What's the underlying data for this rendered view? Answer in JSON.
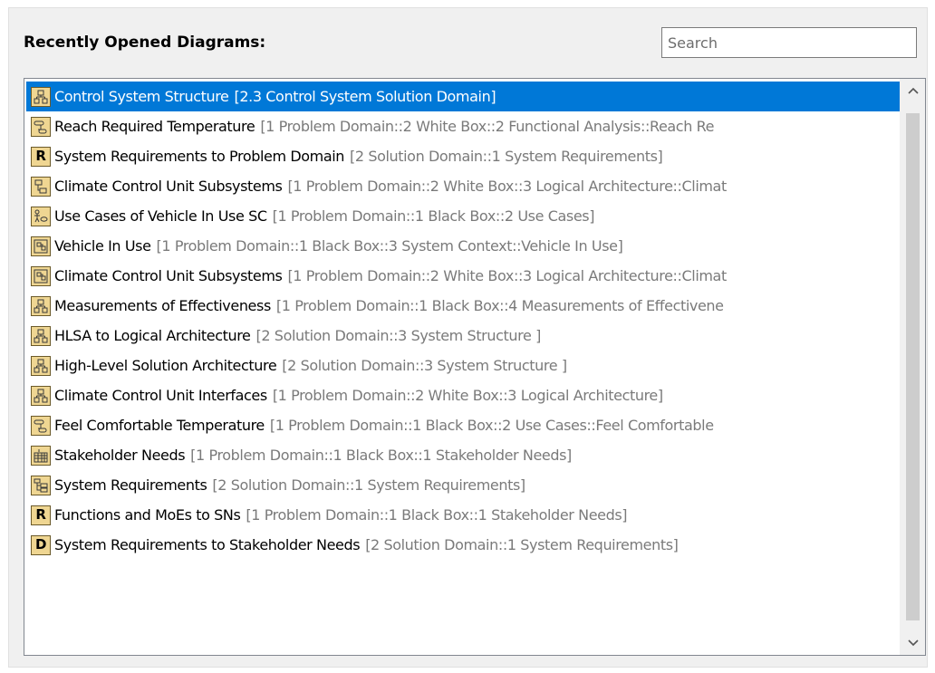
{
  "header": {
    "title": "Recently Opened Diagrams:"
  },
  "search": {
    "placeholder": "Search",
    "value": ""
  },
  "items": [
    {
      "icon": "class-diagram-icon",
      "name": "Control System Structure",
      "path": "[2.3 Control System Solution Domain]",
      "selected": true
    },
    {
      "icon": "activity-diagram-icon",
      "name": "Reach Required Temperature",
      "path": "[1 Problem Domain::2 White Box::2 Functional Analysis::Reach Re",
      "selected": false
    },
    {
      "icon": "requirement-diagram-icon",
      "name": "System Requirements to Problem Domain",
      "path": "[2 Solution Domain::1 System Requirements]",
      "selected": false
    },
    {
      "icon": "bdd-diagram-icon",
      "name": "Climate Control Unit Subsystems",
      "path": "[1 Problem Domain::2 White Box::3 Logical Architecture::Climat",
      "selected": false
    },
    {
      "icon": "use-case-diagram-icon",
      "name": "Use Cases of Vehicle In Use SC",
      "path": "[1 Problem Domain::1 Black Box::2 Use Cases]",
      "selected": false
    },
    {
      "icon": "ibd-diagram-icon",
      "name": "Vehicle In Use",
      "path": "[1 Problem Domain::1 Black Box::3 System Context::Vehicle In Use]",
      "selected": false
    },
    {
      "icon": "ibd-diagram-icon",
      "name": "Climate Control Unit Subsystems",
      "path": "[1 Problem Domain::2 White Box::3 Logical Architecture::Climat",
      "selected": false
    },
    {
      "icon": "class-diagram-icon",
      "name": "Measurements of Effectiveness",
      "path": "[1 Problem Domain::1 Black Box::4 Measurements of Effectivene",
      "selected": false
    },
    {
      "icon": "class-diagram-icon",
      "name": "HLSA to Logical Architecture",
      "path": "[2 Solution Domain::3 System Structure ]",
      "selected": false
    },
    {
      "icon": "class-diagram-icon",
      "name": "High-Level Solution Architecture",
      "path": "[2 Solution Domain::3 System Structure ]",
      "selected": false
    },
    {
      "icon": "class-diagram-icon",
      "name": "Climate Control Unit Interfaces",
      "path": "[1 Problem Domain::2 White Box::3 Logical Architecture]",
      "selected": false
    },
    {
      "icon": "activity-diagram-icon",
      "name": "Feel Comfortable Temperature",
      "path": "[1 Problem Domain::1 Black Box::2 Use Cases::Feel Comfortable",
      "selected": false
    },
    {
      "icon": "requirement-table-icon",
      "name": "Stakeholder Needs",
      "path": "[1 Problem Domain::1 Black Box::1 Stakeholder Needs]",
      "selected": false
    },
    {
      "icon": "containment-diagram-icon",
      "name": "System Requirements",
      "path": "[2 Solution Domain::1 System Requirements]",
      "selected": false
    },
    {
      "icon": "requirement-diagram-icon",
      "name": "Functions and MoEs to SNs",
      "path": "[1 Problem Domain::1 Black Box::1 Stakeholder Needs]",
      "selected": false
    },
    {
      "icon": "dependency-matrix-icon",
      "name": "System Requirements to Stakeholder Needs",
      "path": "[2 Solution Domain::1 System Requirements]",
      "selected": false
    }
  ],
  "icon_letters": {
    "requirement-diagram-icon": "R",
    "dependency-matrix-icon": "D"
  },
  "colors": {
    "selection": "#0078d7",
    "icon_fill": "#efd692",
    "path_text": "#7a7a7a"
  }
}
